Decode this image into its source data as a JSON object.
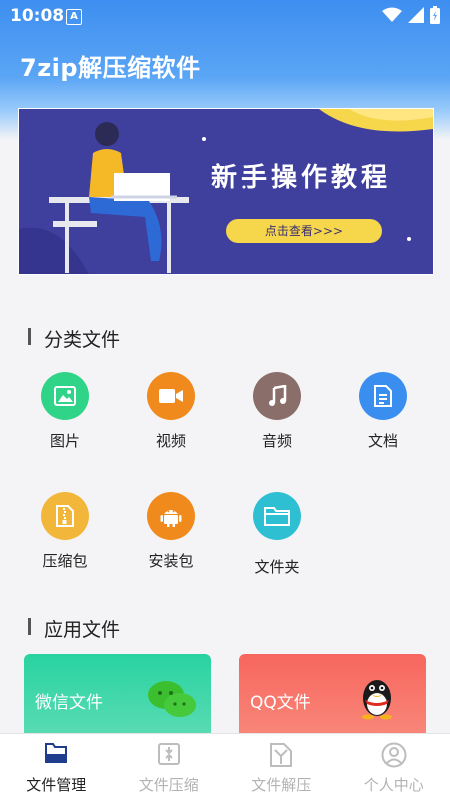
{
  "status_bar": {
    "time": "10:08",
    "notification_badge": "A"
  },
  "header": {
    "title": "7zip解压缩软件"
  },
  "banner": {
    "title": "新手操作教程",
    "button_label": "点击查看>>>"
  },
  "categories_section": {
    "title": "分类文件",
    "items": [
      {
        "label": "图片",
        "icon": "image-icon",
        "color": "#2fd488"
      },
      {
        "label": "视频",
        "icon": "video-icon",
        "color": "#f08a1c"
      },
      {
        "label": "音频",
        "icon": "music-icon",
        "color": "#8a6e69"
      },
      {
        "label": "文档",
        "icon": "document-icon",
        "color": "#3a8ef0"
      },
      {
        "label": "压缩包",
        "icon": "zip-icon",
        "color": "#f2b73a"
      },
      {
        "label": "安装包",
        "icon": "android-icon",
        "color": "#f08a1c"
      },
      {
        "label": "文件夹",
        "icon": "folder-icon",
        "color": "#2fbfd2"
      }
    ]
  },
  "apps_section": {
    "title": "应用文件",
    "cards": [
      {
        "label": "微信文件",
        "icon": "wechat-icon",
        "color": "#3fd2a0"
      },
      {
        "label": "QQ文件",
        "icon": "qq-icon",
        "color": "#f5706a"
      }
    ]
  },
  "bottom_nav": {
    "active": "文件管理",
    "items": [
      {
        "label": "文件管理",
        "icon": "file-manage-icon"
      },
      {
        "label": "文件压缩",
        "icon": "file-compress-icon"
      },
      {
        "label": "文件解压",
        "icon": "file-extract-icon"
      },
      {
        "label": "个人中心",
        "icon": "profile-icon"
      }
    ]
  }
}
